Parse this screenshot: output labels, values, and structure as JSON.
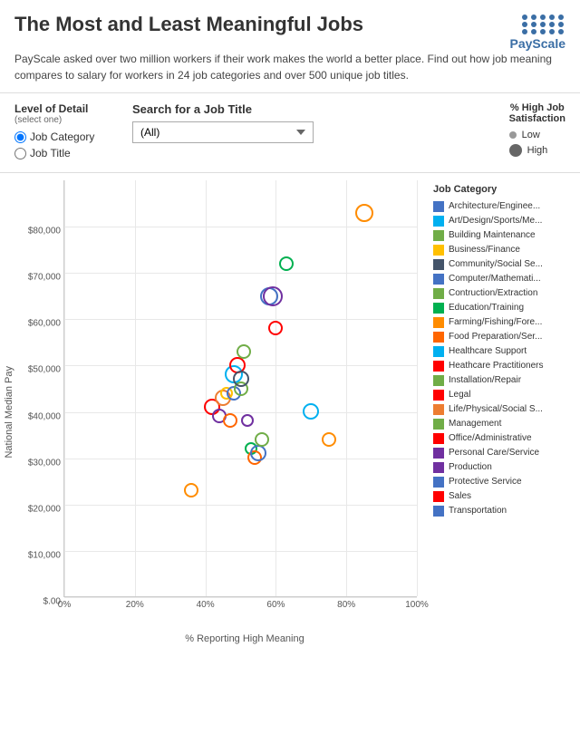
{
  "header": {
    "title": "The Most and Least Meaningful Jobs",
    "description": "PayScale asked over two million workers if their work makes the world a better place. Find out how job meaning compares to salary for workers in 24 job categories and over 500 unique job titles.",
    "payscale_label": "PayScale"
  },
  "controls": {
    "level_of_detail_label": "Level of Detail",
    "level_of_detail_sublabel": "(select one)",
    "radio_job_category": "Job Category",
    "radio_job_title": "Job Title",
    "search_label": "Search for a Job Title",
    "search_placeholder": "(All)",
    "satisfaction_label": "% High Job Satisfaction",
    "satisfaction_low": "Low",
    "satisfaction_high": "High"
  },
  "chart": {
    "y_axis_label": "National Median Pay",
    "x_axis_label": "% Reporting High Meaning",
    "y_ticks": [
      "$,00",
      "$10,000",
      "$20,000",
      "$30,000",
      "$40,000",
      "$50,000",
      "$60,000",
      "$70,000",
      "$80,000"
    ],
    "x_ticks": [
      "0%",
      "20%",
      "40%",
      "60%",
      "80%",
      "100%"
    ]
  },
  "legend": {
    "title": "Job Category",
    "items": [
      {
        "label": "Architecture/Enginee...",
        "color": "#4472C4"
      },
      {
        "label": "Art/Design/Sports/Me...",
        "color": "#00B0F0"
      },
      {
        "label": "Building Maintenance",
        "color": "#70AD47"
      },
      {
        "label": "Business/Finance",
        "color": "#FFC000"
      },
      {
        "label": "Community/Social Se...",
        "color": "#44546A"
      },
      {
        "label": "Computer/Mathemati...",
        "color": "#4472C4"
      },
      {
        "label": "Contruction/Extraction",
        "color": "#70AD47"
      },
      {
        "label": "Education/Training",
        "color": "#00B050"
      },
      {
        "label": "Farming/Fishing/Fore...",
        "color": "#FF8C00"
      },
      {
        "label": "Food Preparation/Ser...",
        "color": "#FF6600"
      },
      {
        "label": "Healthcare Support",
        "color": "#00B0F0"
      },
      {
        "label": "Heathcare Practitioners",
        "color": "#FF0000"
      },
      {
        "label": "Installation/Repair",
        "color": "#70AD47"
      },
      {
        "label": "Legal",
        "color": "#FF0000"
      },
      {
        "label": "Life/Physical/Social S...",
        "color": "#ED7D31"
      },
      {
        "label": "Management",
        "color": "#70AD47"
      },
      {
        "label": "Office/Administrative",
        "color": "#FF0000"
      },
      {
        "label": "Personal Care/Service",
        "color": "#7030A0"
      },
      {
        "label": "Production",
        "color": "#7030A0"
      },
      {
        "label": "Protective Service",
        "color": "#4472C4"
      },
      {
        "label": "Sales",
        "color": "#FF0000"
      },
      {
        "label": "Transportation",
        "color": "#4472C4"
      }
    ]
  },
  "bubbles": [
    {
      "x": 36,
      "y": 23000,
      "size": 16,
      "color": "#FF8C00"
    },
    {
      "x": 42,
      "y": 41000,
      "size": 18,
      "color": "#FF0000"
    },
    {
      "x": 44,
      "y": 39000,
      "size": 16,
      "color": "#7030A0"
    },
    {
      "x": 45,
      "y": 43000,
      "size": 18,
      "color": "#ED7D31"
    },
    {
      "x": 46,
      "y": 44000,
      "size": 14,
      "color": "#FFC000"
    },
    {
      "x": 47,
      "y": 38000,
      "size": 16,
      "color": "#FF6600"
    },
    {
      "x": 48,
      "y": 44000,
      "size": 16,
      "color": "#4472C4"
    },
    {
      "x": 48,
      "y": 48000,
      "size": 20,
      "color": "#00B0F0"
    },
    {
      "x": 49,
      "y": 50000,
      "size": 18,
      "color": "#FF0000"
    },
    {
      "x": 50,
      "y": 45000,
      "size": 16,
      "color": "#70AD47"
    },
    {
      "x": 50,
      "y": 47000,
      "size": 18,
      "color": "#44546A"
    },
    {
      "x": 51,
      "y": 53000,
      "size": 16,
      "color": "#70AD47"
    },
    {
      "x": 52,
      "y": 38000,
      "size": 14,
      "color": "#7030A0"
    },
    {
      "x": 53,
      "y": 32000,
      "size": 14,
      "color": "#00B050"
    },
    {
      "x": 54,
      "y": 30000,
      "size": 16,
      "color": "#FF6600"
    },
    {
      "x": 55,
      "y": 31000,
      "size": 18,
      "color": "#4472C4"
    },
    {
      "x": 56,
      "y": 34000,
      "size": 16,
      "color": "#70AD47"
    },
    {
      "x": 58,
      "y": 65000,
      "size": 20,
      "color": "#4472C4"
    },
    {
      "x": 59,
      "y": 65000,
      "size": 22,
      "color": "#7030A0"
    },
    {
      "x": 60,
      "y": 58000,
      "size": 16,
      "color": "#FF0000"
    },
    {
      "x": 63,
      "y": 72000,
      "size": 16,
      "color": "#00B050"
    },
    {
      "x": 70,
      "y": 40000,
      "size": 18,
      "color": "#00B0F0"
    },
    {
      "x": 75,
      "y": 34000,
      "size": 16,
      "color": "#FF8C00"
    },
    {
      "x": 85,
      "y": 83000,
      "size": 20,
      "color": "#FF8C00"
    }
  ]
}
